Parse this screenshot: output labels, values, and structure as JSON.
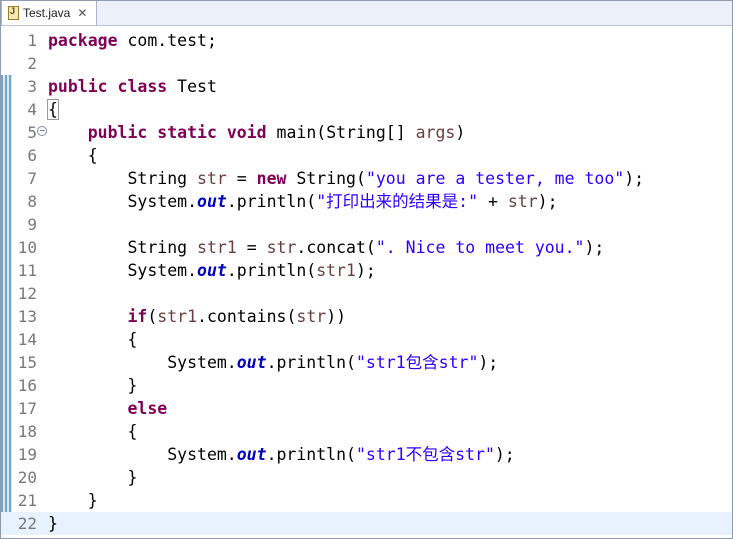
{
  "tab": {
    "title": "Test.java",
    "close": "✕",
    "icon": "java-file-icon"
  },
  "current_line": 22,
  "lines": [
    {
      "n": "1",
      "tokens": [
        {
          "t": "package",
          "c": "kw"
        },
        {
          "t": " com.test;"
        }
      ]
    },
    {
      "n": "2",
      "tokens": []
    },
    {
      "n": "3",
      "tokens": [
        {
          "t": "public",
          "c": "kw"
        },
        {
          "t": " "
        },
        {
          "t": "class",
          "c": "kw"
        },
        {
          "t": " Test"
        }
      ]
    },
    {
      "n": "4",
      "tokens": [
        {
          "t": "{",
          "c": "brace-box"
        }
      ]
    },
    {
      "n": "5",
      "fold": "⊖",
      "tokens": [
        {
          "t": "    "
        },
        {
          "t": "public",
          "c": "kw"
        },
        {
          "t": " "
        },
        {
          "t": "static",
          "c": "kw"
        },
        {
          "t": " "
        },
        {
          "t": "void",
          "c": "kw"
        },
        {
          "t": " main(String[] "
        },
        {
          "t": "args",
          "c": "var"
        },
        {
          "t": ")"
        }
      ]
    },
    {
      "n": "6",
      "tokens": [
        {
          "t": "    {"
        }
      ]
    },
    {
      "n": "7",
      "tokens": [
        {
          "t": "        String "
        },
        {
          "t": "str",
          "c": "var"
        },
        {
          "t": " = "
        },
        {
          "t": "new",
          "c": "kw"
        },
        {
          "t": " String("
        },
        {
          "t": "\"you are a tester, me too\"",
          "c": "str"
        },
        {
          "t": ");"
        }
      ]
    },
    {
      "n": "8",
      "tokens": [
        {
          "t": "        System."
        },
        {
          "t": "out",
          "c": "fld"
        },
        {
          "t": ".println("
        },
        {
          "t": "\"打印出来的结果是:\"",
          "c": "str"
        },
        {
          "t": " + "
        },
        {
          "t": "str",
          "c": "var"
        },
        {
          "t": ");"
        }
      ]
    },
    {
      "n": "9",
      "tokens": []
    },
    {
      "n": "10",
      "tokens": [
        {
          "t": "        String "
        },
        {
          "t": "str1",
          "c": "var"
        },
        {
          "t": " = "
        },
        {
          "t": "str",
          "c": "var"
        },
        {
          "t": ".concat("
        },
        {
          "t": "\". Nice to meet you.\"",
          "c": "str"
        },
        {
          "t": ");"
        }
      ]
    },
    {
      "n": "11",
      "tokens": [
        {
          "t": "        System."
        },
        {
          "t": "out",
          "c": "fld"
        },
        {
          "t": ".println("
        },
        {
          "t": "str1",
          "c": "var"
        },
        {
          "t": ");"
        }
      ]
    },
    {
      "n": "12",
      "tokens": []
    },
    {
      "n": "13",
      "tokens": [
        {
          "t": "        "
        },
        {
          "t": "if",
          "c": "kw"
        },
        {
          "t": "("
        },
        {
          "t": "str1",
          "c": "var"
        },
        {
          "t": ".contains("
        },
        {
          "t": "str",
          "c": "var"
        },
        {
          "t": "))"
        }
      ]
    },
    {
      "n": "14",
      "tokens": [
        {
          "t": "        {"
        }
      ]
    },
    {
      "n": "15",
      "tokens": [
        {
          "t": "            System."
        },
        {
          "t": "out",
          "c": "fld"
        },
        {
          "t": ".println("
        },
        {
          "t": "\"str1包含str\"",
          "c": "str"
        },
        {
          "t": ");"
        }
      ]
    },
    {
      "n": "16",
      "tokens": [
        {
          "t": "        }"
        }
      ]
    },
    {
      "n": "17",
      "tokens": [
        {
          "t": "        "
        },
        {
          "t": "else",
          "c": "kw"
        }
      ]
    },
    {
      "n": "18",
      "tokens": [
        {
          "t": "        {"
        }
      ]
    },
    {
      "n": "19",
      "tokens": [
        {
          "t": "            System."
        },
        {
          "t": "out",
          "c": "fld"
        },
        {
          "t": ".println("
        },
        {
          "t": "\"str1不包含str\"",
          "c": "str"
        },
        {
          "t": ");"
        }
      ]
    },
    {
      "n": "20",
      "tokens": [
        {
          "t": "        }"
        }
      ]
    },
    {
      "n": "21",
      "tokens": [
        {
          "t": "    }"
        }
      ]
    },
    {
      "n": "22",
      "tokens": [
        {
          "t": "}"
        }
      ]
    }
  ]
}
